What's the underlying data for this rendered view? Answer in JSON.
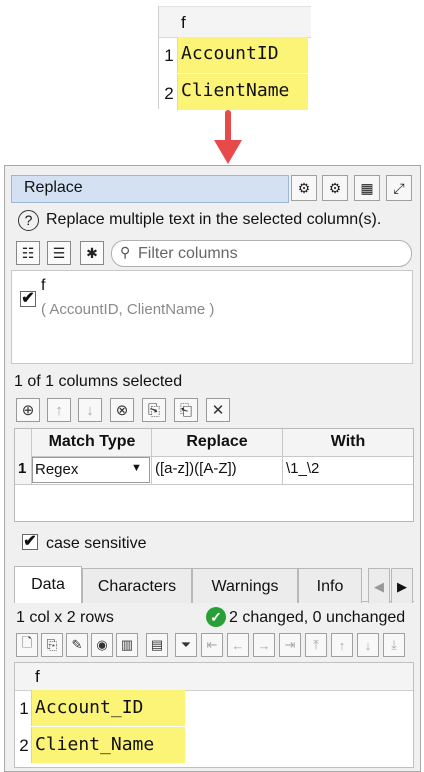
{
  "top_table": {
    "header": "f",
    "rows": [
      {
        "num": "1",
        "value": "AccountID"
      },
      {
        "num": "2",
        "value": "ClientName"
      }
    ]
  },
  "panel": {
    "title": "Replace",
    "description": "Replace multiple text in the selected column(s).",
    "filter_placeholder": "Filter columns",
    "column": {
      "name": "f",
      "sample": "( AccountID, ClientName )"
    },
    "columns_selected": "1 of 1 columns selected",
    "grid": {
      "headers": [
        "Match Type",
        "Replace",
        "With"
      ],
      "row": {
        "num": "1",
        "match_type": "Regex",
        "replace": "([a-z])([A-Z])",
        "with": "\\1_\\2"
      }
    },
    "case_sensitive_label": "case sensitive"
  },
  "tabs": [
    "Data",
    "Characters",
    "Warnings",
    "Info"
  ],
  "data_info": {
    "size": "1 col x 2 rows",
    "changed": "2 changed, 0 unchanged"
  },
  "result_table": {
    "header": "f",
    "rows": [
      {
        "num": "1",
        "value": "Account_ID"
      },
      {
        "num": "2",
        "value": "Client_Name"
      }
    ]
  },
  "colors": {
    "highlight": "#fbf477",
    "arrow": "#e84a4a",
    "title_bg": "#d3e1f3",
    "ok_green": "#29a037"
  }
}
